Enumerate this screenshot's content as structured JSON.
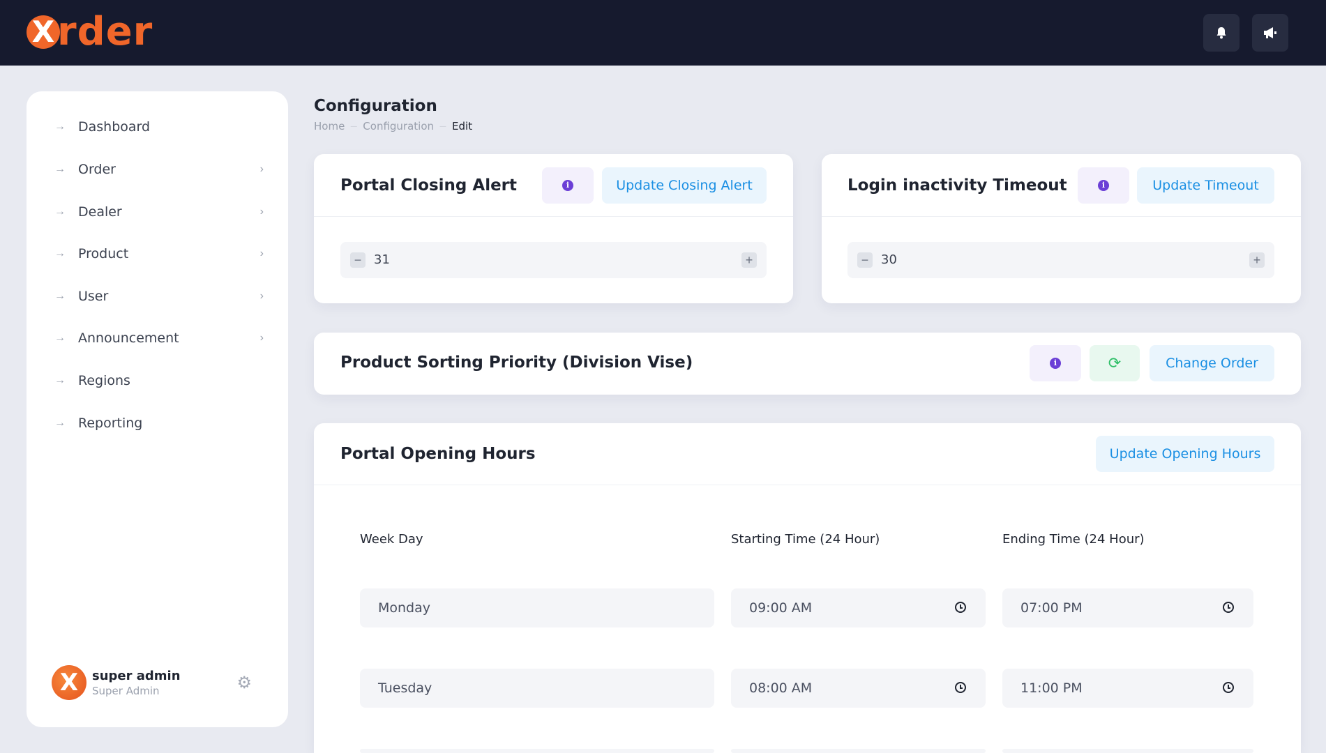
{
  "header": {
    "logo_letter": "X",
    "logo_text": "rder",
    "notifications_icon": "bell-icon",
    "announcements_icon": "megaphone-icon"
  },
  "sidebar": {
    "items": [
      {
        "label": "Dashboard",
        "has_children": false
      },
      {
        "label": "Order",
        "has_children": true
      },
      {
        "label": "Dealer",
        "has_children": true
      },
      {
        "label": "Product",
        "has_children": true
      },
      {
        "label": "User",
        "has_children": true
      },
      {
        "label": "Announcement",
        "has_children": true
      },
      {
        "label": "Regions",
        "has_children": false
      },
      {
        "label": "Reporting",
        "has_children": false
      }
    ],
    "user": {
      "avatar_letter": "X",
      "name": "super admin",
      "role": "Super Admin"
    }
  },
  "page": {
    "title": "Configuration",
    "breadcrumb": [
      "Home",
      "Configuration",
      "Edit"
    ]
  },
  "portal_closing_alert": {
    "title": "Portal Closing Alert",
    "info": "i",
    "button": "Update Closing Alert",
    "value": "31"
  },
  "login_timeout": {
    "title": "Login inactivity Timeout",
    "info": "i",
    "button": "Update Timeout",
    "value": "30"
  },
  "product_sorting": {
    "title": "Product Sorting Priority (Division Vise)",
    "info": "i",
    "button": "Change Order"
  },
  "opening_hours": {
    "title": "Portal Opening Hours",
    "button": "Update Opening Hours",
    "columns": [
      "Week Day",
      "Starting Time (24 Hour)",
      "Ending Time (24 Hour)"
    ],
    "rows": [
      {
        "day": "Monday",
        "start": "09:00  AM",
        "end": "07:00  PM"
      },
      {
        "day": "Tuesday",
        "start": "08:00  AM",
        "end": "11:00  PM"
      }
    ]
  },
  "colors": {
    "brand": "#f0662a",
    "topbar": "#161a2e",
    "accent_blue": "#1a8fe3",
    "info_purple": "#6b3fd6",
    "refresh_green": "#2fbf68"
  }
}
